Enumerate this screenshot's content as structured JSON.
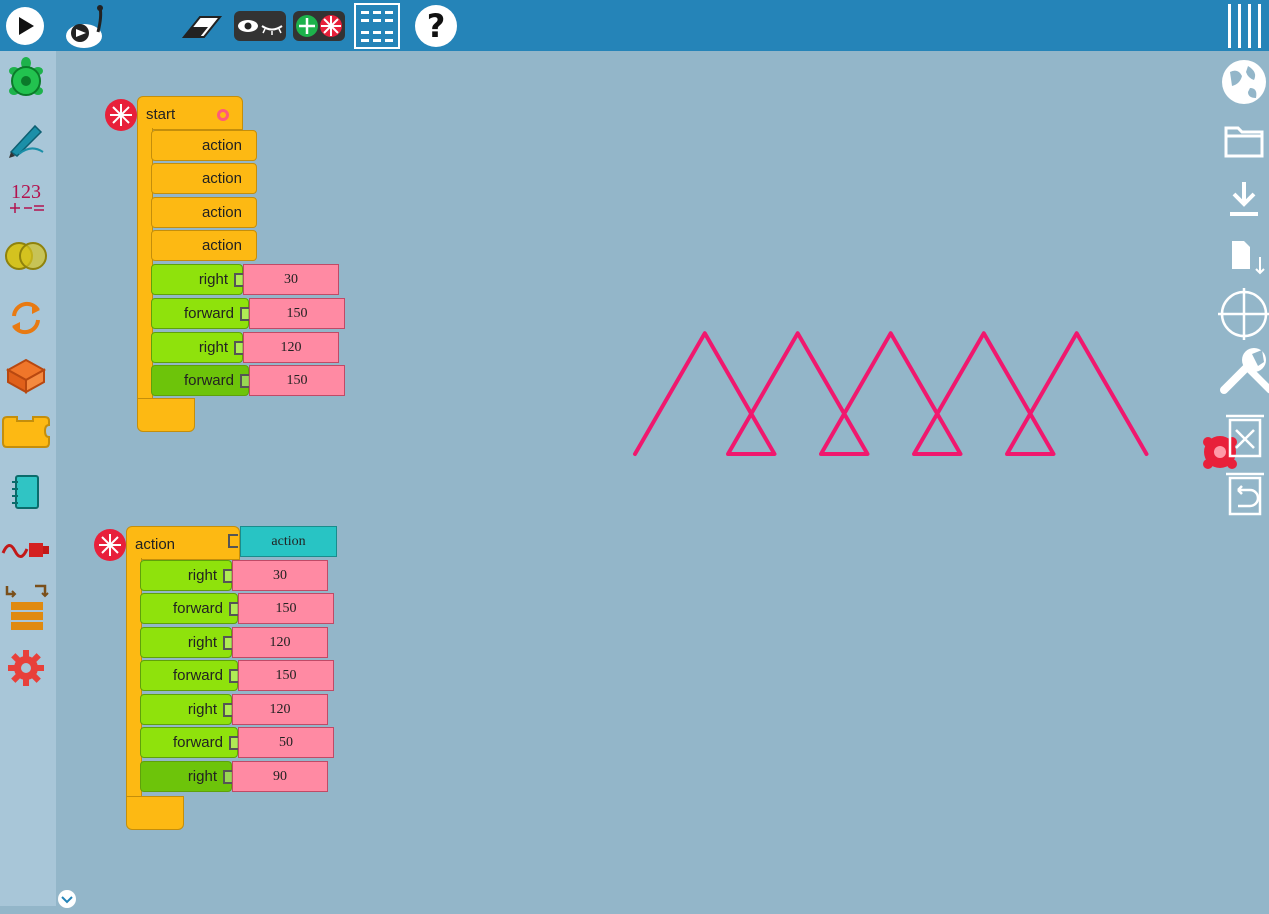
{
  "toolbar": {
    "icons": [
      "run-icon",
      "run-slow-icon",
      "clear-icon",
      "hide-show-blocks-icon",
      "collapse-expand-icon",
      "menu-grid-icon",
      "help-icon",
      "aux-menu-icon"
    ],
    "help_glyph": "?"
  },
  "palette": {
    "items": [
      {
        "name": "turtle-palette-icon"
      },
      {
        "name": "pen-palette-icon"
      },
      {
        "name": "number-palette-icon",
        "glyph": "123"
      },
      {
        "name": "boolean-palette-icon"
      },
      {
        "name": "flow-palette-icon"
      },
      {
        "name": "action-palette-icon"
      },
      {
        "name": "boxes-palette-icon"
      },
      {
        "name": "notebook-palette-icon"
      },
      {
        "name": "extras-palette-icon"
      },
      {
        "name": "program-palette-icon"
      },
      {
        "name": "settings-palette-icon"
      }
    ]
  },
  "right_menu": {
    "icons": [
      "language-globe-icon",
      "open-folder-icon",
      "download-icon",
      "save-file-icon",
      "grid-icon",
      "wrench-icon",
      "clear-trash-icon",
      "restore-icon"
    ]
  },
  "start_stack": {
    "label": "start",
    "actions": [
      "action",
      "action",
      "action",
      "action"
    ],
    "commands": [
      {
        "label": "right",
        "value": "30"
      },
      {
        "label": "forward",
        "value": "150"
      },
      {
        "label": "right",
        "value": "120"
      },
      {
        "label": "forward",
        "value": "150"
      }
    ]
  },
  "action_stack": {
    "label": "action",
    "name_value": "action",
    "commands": [
      {
        "label": "right",
        "value": "30"
      },
      {
        "label": "forward",
        "value": "150"
      },
      {
        "label": "right",
        "value": "120"
      },
      {
        "label": "forward",
        "value": "150"
      },
      {
        "label": "right",
        "value": "120"
      },
      {
        "label": "forward",
        "value": "50"
      },
      {
        "label": "right",
        "value": "90"
      }
    ]
  },
  "drawing": {
    "pen_color": "#f0186e",
    "turtle_color": "#e8203a"
  },
  "colors": {
    "topbar": "#2584b8",
    "canvas_bg": "#93b6c9",
    "sidebar_bg": "#a8c6d8"
  }
}
